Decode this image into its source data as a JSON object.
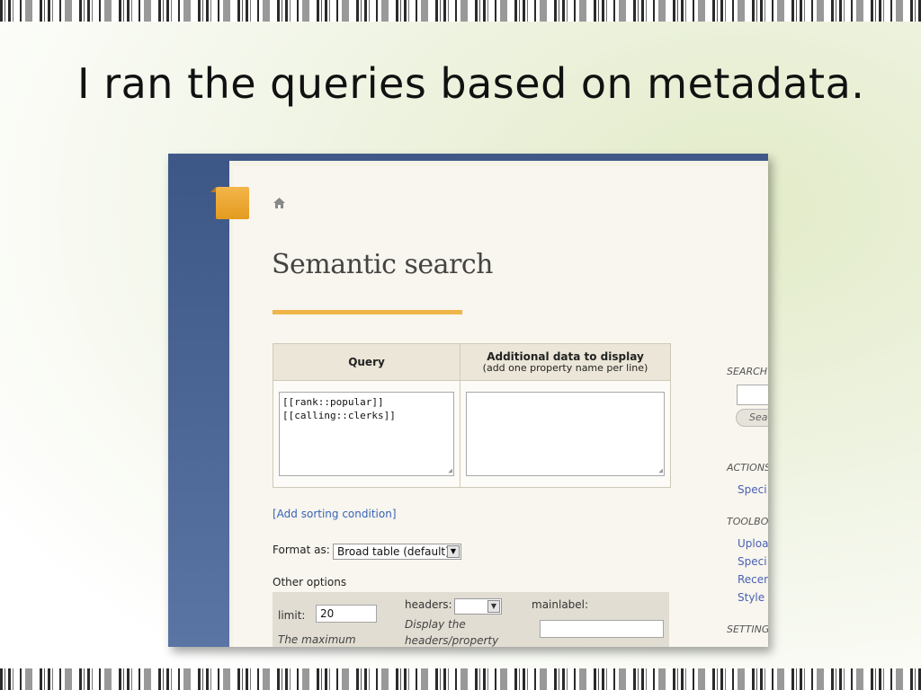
{
  "slide": {
    "title": "I ran the queries based on metadata."
  },
  "screenshot": {
    "home_icon": "home-icon",
    "page_title": "Semantic search",
    "query_table": {
      "query_header": "Query",
      "additional_header": "Additional data to display",
      "additional_subheader": "(add one property name per line)",
      "query_value": "[[rank::popular]]\n[[calling::clerks]]",
      "additional_value": ""
    },
    "add_sorting_link": "[Add sorting condition]",
    "format_label": "Format as:",
    "format_selected": "Broad table (default)",
    "other_options_label": "Other options",
    "options": {
      "limit_label": "limit:",
      "limit_value": "20",
      "limit_help": "The maximum",
      "headers_label": "headers:",
      "headers_value": "",
      "headers_help_1": "Display the",
      "headers_help_2": "headers/property",
      "mainlabel_label": "mainlabel:",
      "mainlabel_value": ""
    },
    "sidebar": {
      "search_heading": "SEARCH",
      "search_button": "Sea",
      "actions_heading": "ACTIONS",
      "actions_items": [
        "Speci"
      ],
      "toolbox_heading": "TOOLBO",
      "toolbox_items": [
        "Uploa",
        "Speci",
        "Recen",
        "Style"
      ],
      "settings_heading": "SETTING"
    }
  },
  "colors": {
    "accent": "#f0b548",
    "sidebar_blue": "#4a6493",
    "link": "#3a63b8"
  }
}
